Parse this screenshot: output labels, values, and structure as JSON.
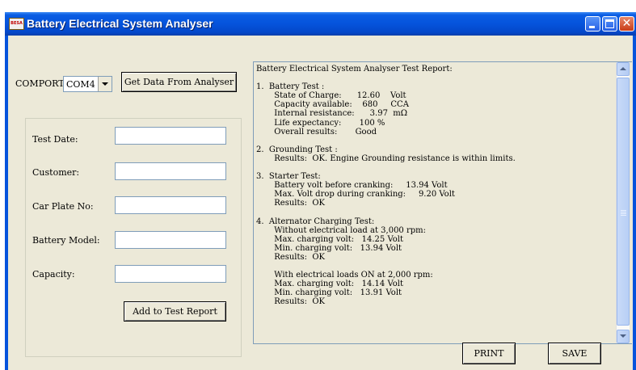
{
  "window": {
    "title": "Battery Electrical System Analyser",
    "icon_text": "BESA"
  },
  "comport": {
    "label": "COMPORT:",
    "value": "COM4",
    "get_data_button": "Get Data From Analyser"
  },
  "form": {
    "fields": [
      {
        "label": "Test Date:",
        "value": ""
      },
      {
        "label": "Customer:",
        "value": ""
      },
      {
        "label": "Car Plate No:",
        "value": ""
      },
      {
        "label": "Battery Model:",
        "value": ""
      },
      {
        "label": "Capacity:",
        "value": ""
      }
    ],
    "add_button": "Add to Test Report"
  },
  "report": {
    "text": "Battery Electrical System Analyser Test Report:\n\n1.  Battery Test :\n       State of Charge:      12.60    Volt\n       Capacity available:    680     CCA\n       Internal resistance:      3.97  mΩ\n       Life expectancy:       100 %\n       Overall results:       Good\n\n2.  Grounding Test :\n       Results:  OK. Engine Grounding resistance is within limits.\n\n3.  Starter Test:\n       Battery volt before cranking:     13.94 Volt\n       Max. Volt drop during cranking:     9.20 Volt\n       Results:  OK\n\n4.  Alternator Charging Test:\n       Without electrical load at 3,000 rpm:\n       Max. charging volt:   14.25 Volt\n       Min. charging volt:   13.94 Volt\n       Results:  OK\n\n       With electrical loads ON at 2,000 rpm:\n       Max. charging volt:   14.14 Volt\n       Min. charging volt:   13.91 Volt\n       Results:  OK"
  },
  "buttons": {
    "print": "PRINT",
    "save": "SAVE"
  },
  "icons": [
    "app-icon",
    "minimize-icon",
    "maximize-icon",
    "close-icon",
    "chevron-down-icon",
    "scroll-up-arrow-icon",
    "scroll-down-arrow-icon"
  ],
  "colors": {
    "titlebar": "#0553dc",
    "background": "#ece9d8",
    "close_button": "#c93c17"
  }
}
